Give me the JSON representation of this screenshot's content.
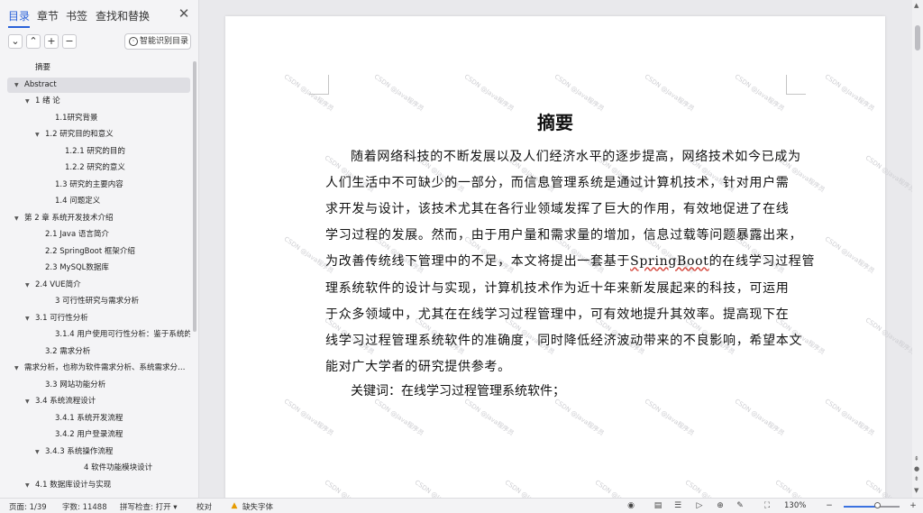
{
  "nav": {
    "tabs": [
      "目录",
      "章节",
      "书签",
      "查找和替换"
    ],
    "active_tab": 0,
    "close_label": "✕",
    "toolbar": {
      "collapse_icon": "chevron-down-icon",
      "expand_icon": "chevron-up-icon",
      "add_icon": "plus-icon",
      "remove_icon": "minus-icon",
      "ai_toc_label": "智能识别目录"
    },
    "toc": [
      {
        "label": "摘要",
        "level": 1,
        "arrow": false
      },
      {
        "label": "Abstract",
        "level": 0,
        "arrow": true,
        "selected": true
      },
      {
        "label": "1 绪 论",
        "level": 1,
        "arrow": true
      },
      {
        "label": "1.1研究背景",
        "level": 3,
        "arrow": false
      },
      {
        "label": "1.2 研究目的和意义",
        "level": 2,
        "arrow": true
      },
      {
        "label": "1.2.1 研究的目的",
        "level": 4,
        "arrow": false
      },
      {
        "label": "1.2.2 研究的意义",
        "level": 4,
        "arrow": false
      },
      {
        "label": "1.3 研究的主要内容",
        "level": 3,
        "arrow": false
      },
      {
        "label": "1.4 问题定义",
        "level": 3,
        "arrow": false
      },
      {
        "label": "第 2 章   系统开发技术介绍",
        "level": 0,
        "arrow": true
      },
      {
        "label": "2.1 Java 语言简介",
        "level": 2,
        "arrow": false
      },
      {
        "label": "2.2 SpringBoot 框架介绍",
        "level": 2,
        "arrow": false
      },
      {
        "label": "2.3    MySQL数据库",
        "level": 2,
        "arrow": false
      },
      {
        "label": "2.4    VUE简介",
        "level": 1,
        "arrow": true
      },
      {
        "label": "3 可行性研究与需求分析",
        "level": 3,
        "arrow": false
      },
      {
        "label": "3.1 可行性分析",
        "level": 1,
        "arrow": true
      },
      {
        "label": "3.1.4 用户使用可行性分析：鉴于系统的…",
        "level": 3,
        "arrow": false
      },
      {
        "label": "3.2 需求分析",
        "level": 2,
        "arrow": false
      },
      {
        "label": "需求分析，也称为软件需求分析、系统需求分…",
        "level": 0,
        "arrow": true
      },
      {
        "label": "3.3 网站功能分析",
        "level": 2,
        "arrow": false
      },
      {
        "label": "3.4 系统流程设计",
        "level": 1,
        "arrow": true
      },
      {
        "label": "3.4.1  系统开发流程",
        "level": 3,
        "arrow": false
      },
      {
        "label": "3.4.2  用户登录流程",
        "level": 3,
        "arrow": false
      },
      {
        "label": "3.4.3  系统操作流程",
        "level": 2,
        "arrow": true
      },
      {
        "label": "4  软件功能模块设计",
        "level": 5,
        "arrow": false
      },
      {
        "label": "4.1  数据库设计与实现",
        "level": 1,
        "arrow": true
      }
    ]
  },
  "document": {
    "title": "摘要",
    "lines": [
      {
        "text": "随着网络科技的不断发展以及人们经济水平的逐步提高，网络技术如今已成为",
        "indent": true
      },
      {
        "text": "人们生活中不可缺少的一部分，而信息管理系统是通过计算机技术，针对用户需",
        "indent": false
      },
      {
        "text": "求开发与设计，该技术尤其在各行业领域发挥了巨大的作用，有效地促进了在线",
        "indent": false
      },
      {
        "text": "学习过程的发展。然而，由于用户量和需求量的增加，信息过载等问题暴露出来，",
        "indent": false
      },
      {
        "pre": "为改善传统线下管理中的不足，本文将提出一套基于",
        "mark": "SpringBoot",
        "post": "的在线学习过程管",
        "indent": false
      },
      {
        "text": "理系统软件的设计与实现，计算机技术作为近十年来新发展起来的科技，可运用",
        "indent": false
      },
      {
        "text": "于众多领域中，尤其在在线学习过程管理中，可有效地提升其效率。提高现下在",
        "indent": false
      },
      {
        "text": "线学习过程管理系统软件的准确度，同时降低经济波动带来的不良影响，希望本文",
        "indent": false
      },
      {
        "text": "能对广大学者的研究提供参考。",
        "indent": false
      }
    ],
    "keywords_label": "关键词：",
    "keywords_value": "在线学习过程管理系统软件；",
    "watermark": "CSDN @Java程序员"
  },
  "status": {
    "page": "页面: 1/39",
    "words": "字数: 11488",
    "spellcheck": "拼写检查: 打开",
    "spellcheck_arrow": "▾",
    "proofread": "校对",
    "missing_font": "缺失字体",
    "zoom": "130%",
    "zoom_fraction": 0.62
  }
}
